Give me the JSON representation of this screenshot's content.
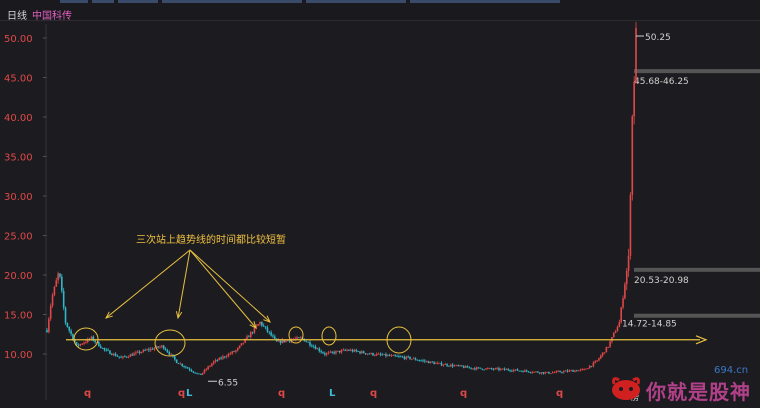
{
  "header": {
    "period": "日线",
    "stock_name": "中国科传"
  },
  "annotation": {
    "text": "三次站上趋势线的时间都比较短暂"
  },
  "watermark": {
    "domain": "694.cn",
    "text": "你就是股神"
  },
  "bottom_hint": "榜",
  "chart_data": {
    "type": "candlestick",
    "ylim": [
      9.0,
      50.25
    ],
    "y_ticks": [
      "50.00",
      "45.00",
      "40.00",
      "35.00",
      "30.00",
      "25.00",
      "20.00",
      "15.00",
      "10.00"
    ],
    "price_labels": {
      "high": "50.25",
      "low": "6.55"
    },
    "resistance_zones": [
      "45.68-46.25",
      "20.53-20.98",
      "14.72-14.85"
    ],
    "trendline_level": 11.8,
    "bottom_markers": [
      {
        "label": "q",
        "color": "#e04848"
      },
      {
        "label": "q",
        "color": "#e04848"
      },
      {
        "label": "L",
        "color": "#40b8d8"
      },
      {
        "label": "q",
        "color": "#e04848"
      },
      {
        "label": "L",
        "color": "#40b8d8"
      },
      {
        "label": "q",
        "color": "#e04848"
      },
      {
        "label": "q",
        "color": "#e04848"
      },
      {
        "label": "q",
        "color": "#e04848"
      }
    ],
    "colors": {
      "up": "#e04848",
      "down": "#30b8c8",
      "trend": "#e8c040",
      "axis": "#e04848"
    }
  }
}
